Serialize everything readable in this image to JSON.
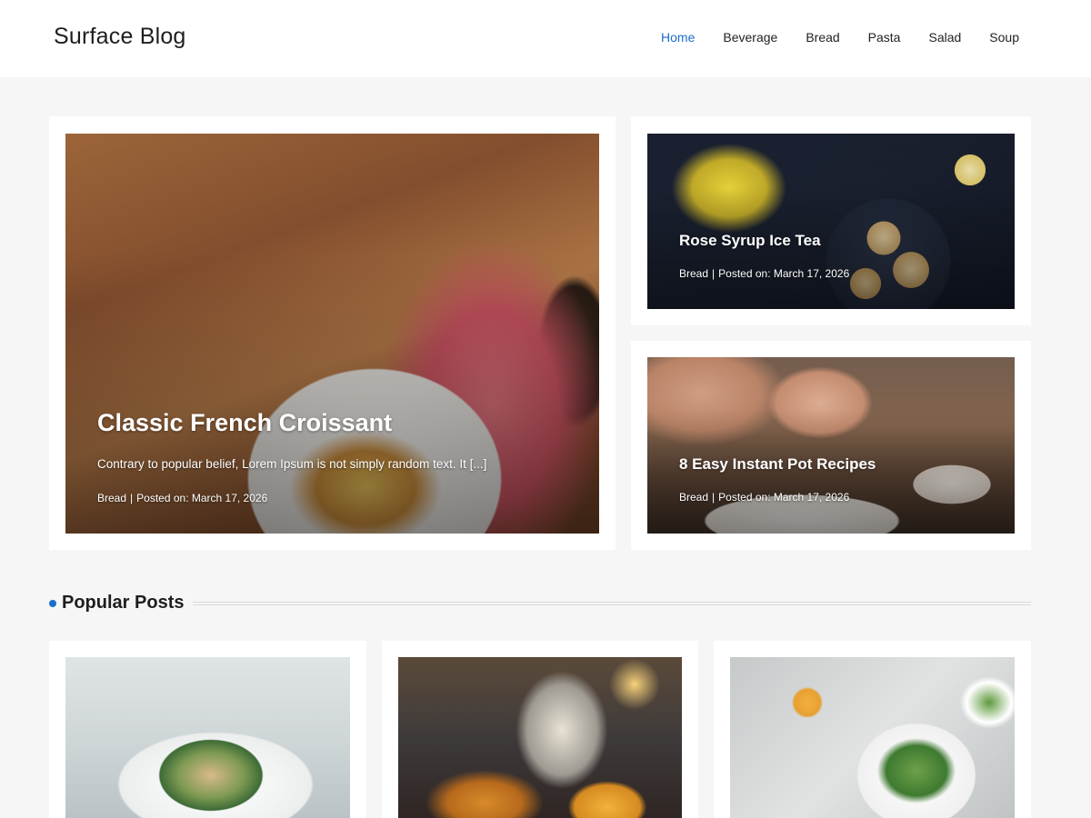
{
  "site": {
    "title": "Surface Blog"
  },
  "nav": {
    "items": [
      {
        "label": "Home",
        "active": true
      },
      {
        "label": "Beverage",
        "active": false
      },
      {
        "label": "Bread",
        "active": false
      },
      {
        "label": "Pasta",
        "active": false
      },
      {
        "label": "Salad",
        "active": false
      },
      {
        "label": "Soup",
        "active": false
      }
    ]
  },
  "featured": {
    "main": {
      "title": "Classic French Croissant",
      "excerpt": "Contrary to popular belief, Lorem Ipsum is not simply random text. It [...]",
      "category": "Bread",
      "separator": "|",
      "posted": "Posted on: March 17, 2026",
      "image": "pasta-plate-photo"
    },
    "side": [
      {
        "title": "Rose Syrup Ice Tea",
        "category": "Bread",
        "separator": "|",
        "posted": "Posted on: March 17, 2026",
        "image": "cookies-flowers-photo"
      },
      {
        "title": "8 Easy Instant Pot Recipes",
        "category": "Bread",
        "separator": "|",
        "posted": "Posted on: March 17, 2026",
        "image": "chef-plating-photo"
      }
    ]
  },
  "popular": {
    "heading": "Popular Posts",
    "accent_color": "#1a6fc9",
    "posts": [
      {
        "image": "salad-plate-photo"
      },
      {
        "image": "burger-fries-photo"
      },
      {
        "image": "green-salad-photo"
      }
    ]
  },
  "colors": {
    "accent": "#1a6fc9",
    "background": "#f6f6f6",
    "card": "#ffffff",
    "text": "#1e1e1e"
  }
}
